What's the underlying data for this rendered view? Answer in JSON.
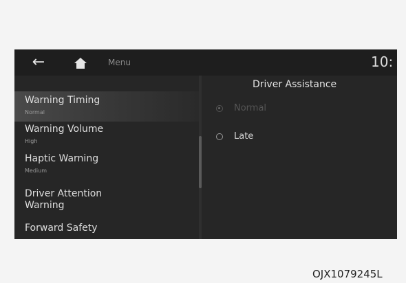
{
  "header": {
    "menu_label": "Menu",
    "clock": "10:",
    "back_icon": "arrow-left-icon",
    "home_icon": "home-icon"
  },
  "panel": {
    "title": "Driver Assistance"
  },
  "menu_items": [
    {
      "title": "Warning Timing",
      "value": "Normal",
      "selected": true
    },
    {
      "title": "Warning Volume",
      "value": "High"
    },
    {
      "title": "Haptic Warning",
      "value": "Medium"
    },
    {
      "title": "Driver Attention Warning"
    },
    {
      "title": "Forward Safety"
    }
  ],
  "options": [
    {
      "label": "Normal",
      "checked": true,
      "disabled": true
    },
    {
      "label": "Late",
      "checked": false
    }
  ],
  "caption": "OJX1079245L"
}
